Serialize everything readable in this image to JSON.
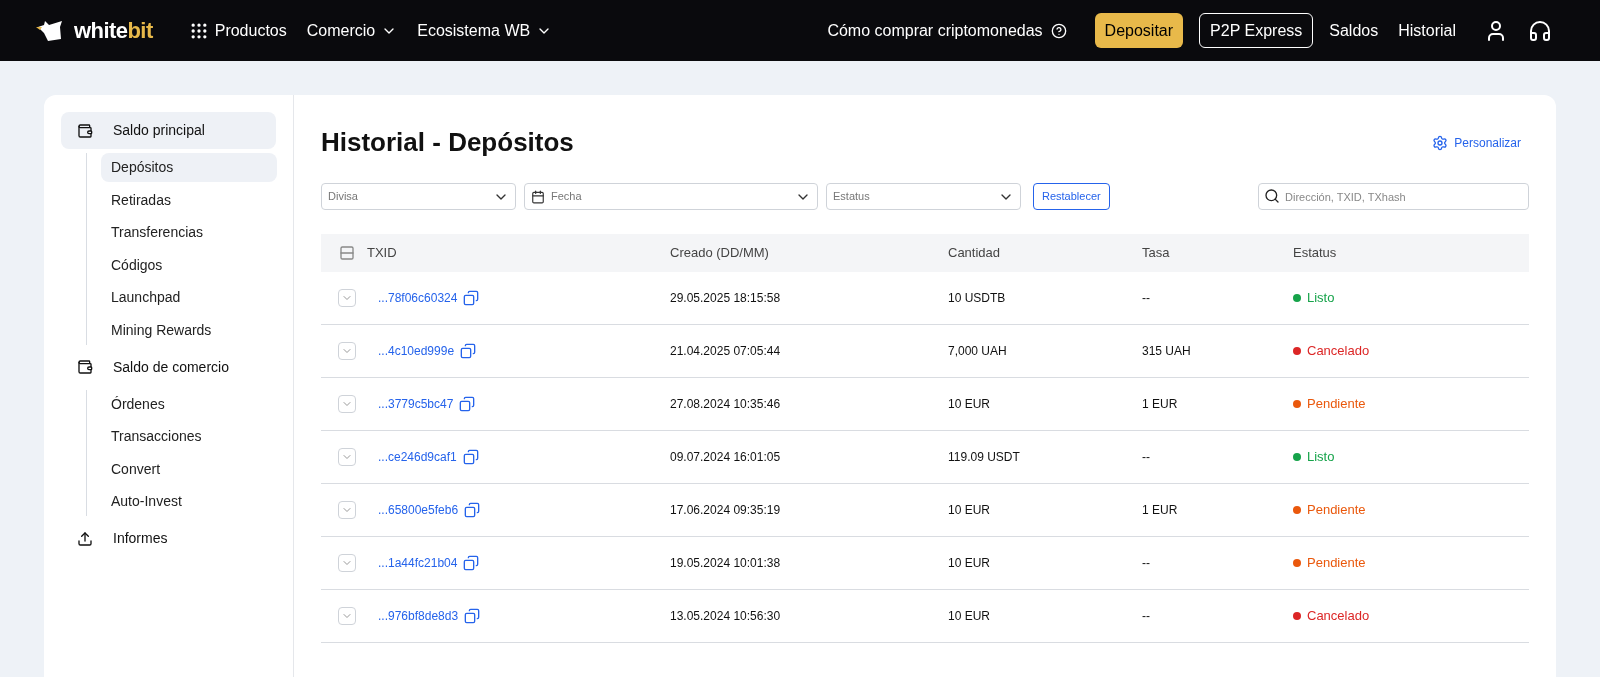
{
  "header": {
    "logo": {
      "part_1": "white",
      "part_2": "bit"
    },
    "nav": [
      {
        "label": "Productos",
        "kind": "grid"
      },
      {
        "label": "Comercio",
        "kind": "dropdown"
      },
      {
        "label": "Ecosistema WB",
        "kind": "dropdown"
      }
    ],
    "help_link": "Cómo comprar criptomonedas",
    "deposit_button": "Depositar",
    "p2p_button": "P2P Express",
    "links": [
      "Saldos",
      "Historial"
    ]
  },
  "sidebar": {
    "sections": [
      {
        "label": "Saldo principal",
        "kind": "balance",
        "selected": true,
        "children": [
          {
            "label": "Depósitos",
            "selected": true
          },
          {
            "label": "Retiradas",
            "selected": false
          },
          {
            "label": "Transferencias",
            "selected": false
          },
          {
            "label": "Códigos",
            "selected": false
          },
          {
            "label": "Launchpad",
            "selected": false
          },
          {
            "label": "Mining Rewards",
            "selected": false
          }
        ]
      },
      {
        "label": "Saldo de comercio",
        "kind": "balance",
        "selected": false,
        "children": [
          {
            "label": "Órdenes",
            "selected": false
          },
          {
            "label": "Transacciones",
            "selected": false
          },
          {
            "label": "Convert",
            "selected": false
          },
          {
            "label": "Auto-Invest",
            "selected": false
          }
        ]
      },
      {
        "label": "Informes",
        "kind": "report",
        "selected": false
      }
    ]
  },
  "main": {
    "title": "Historial - Depósitos",
    "customize": "Personalizar",
    "filters": [
      {
        "placeholder": "Divisa",
        "kind": "select"
      },
      {
        "placeholder": "Fecha",
        "kind": "date"
      },
      {
        "placeholder": "Estatus",
        "kind": "select"
      }
    ],
    "reset_button": "Restablecer",
    "search": {
      "placeholder": "Dirección, TXID, TXhash"
    },
    "table": {
      "columns": [
        "TXID",
        "Creado (DD/MM)",
        "Cantidad",
        "Tasa",
        "Estatus"
      ],
      "rows": [
        {
          "txid": "...78f06c60324",
          "created": "29.05.2025 18:15:58",
          "amount": "10 USDTB",
          "fee": "--",
          "status": "Listo",
          "color": "#16a34a"
        },
        {
          "txid": "...4c10ed999e",
          "created": "21.04.2025 07:05:44",
          "amount": "7,000 UAH",
          "fee": "315 UAH",
          "status": "Cancelado",
          "color": "#dc2626"
        },
        {
          "txid": "...3779c5bc47",
          "created": "27.08.2024 10:35:46",
          "amount": "10 EUR",
          "fee": "1 EUR",
          "status": "Pendiente",
          "color": "#ea580c"
        },
        {
          "txid": "...ce246d9caf1",
          "created": "09.07.2024 16:01:05",
          "amount": "119.09 USDT",
          "fee": "--",
          "status": "Listo",
          "color": "#16a34a"
        },
        {
          "txid": "...65800e5feb6",
          "created": "17.06.2024 09:35:19",
          "amount": "10 EUR",
          "fee": "1 EUR",
          "status": "Pendiente",
          "color": "#ea580c"
        },
        {
          "txid": "...1a44fc21b04",
          "created": "19.05.2024 10:01:38",
          "amount": "10 EUR",
          "fee": "--",
          "status": "Pendiente",
          "color": "#ea580c"
        },
        {
          "txid": "...976bf8de8d3",
          "created": "13.05.2024 10:56:30",
          "amount": "10 EUR",
          "fee": "--",
          "status": "Cancelado",
          "color": "#dc2626"
        }
      ]
    }
  }
}
